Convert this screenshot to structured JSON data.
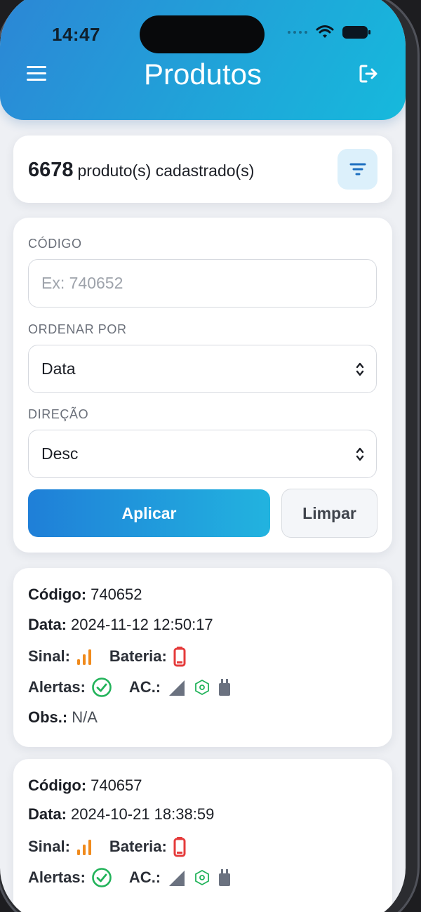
{
  "status_bar": {
    "time": "14:47"
  },
  "header": {
    "title": "Produtos",
    "menu_icon": "hamburger-icon",
    "logout_icon": "logout-icon"
  },
  "summary": {
    "count": "6678",
    "text": "produto(s) cadastrado(s)",
    "filter_icon": "filter-icon"
  },
  "filters": {
    "code_label": "CÓDIGO",
    "code_placeholder": "Ex: 740652",
    "code_value": "",
    "order_label": "ORDENAR POR",
    "order_value": "Data",
    "direction_label": "DIREÇÃO",
    "direction_value": "Desc",
    "apply_label": "Aplicar",
    "clear_label": "Limpar"
  },
  "labels": {
    "codigo": "Código:",
    "data": "Data:",
    "sinal": "Sinal:",
    "bateria": "Bateria:",
    "alertas": "Alertas:",
    "ac": "AC.:",
    "obs": "Obs.:"
  },
  "products": [
    {
      "codigo": "740652",
      "data": "2024-11-12 12:50:17",
      "obs": "N/A"
    },
    {
      "codigo": "740657",
      "data": "2024-10-21 18:38:59"
    }
  ],
  "colors": {
    "header_start": "#2c86d6",
    "header_end": "#16b9dc",
    "signal": "#f08a1c",
    "battery_low": "#e53b3b",
    "alert_ok": "#22b35a"
  }
}
